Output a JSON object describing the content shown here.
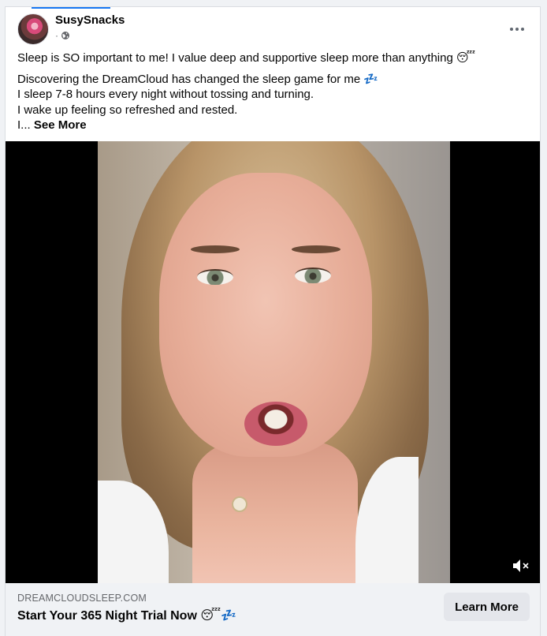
{
  "post": {
    "author": "SusySnacks",
    "meta_dot": "·",
    "privacy_icon": "globe-icon",
    "text_line1": "Sleep is SO important to me! I value deep and supportive sleep more than anything 😴",
    "text_para2_line1": "Discovering the DreamCloud has changed the sleep game for me 💤",
    "text_para2_line2": "I sleep 7-8 hours every night without tossing and turning.",
    "text_para2_line3": "I wake up feeling so refreshed and rested.",
    "text_truncated": "I...",
    "see_more_label": "See More"
  },
  "video": {
    "mute_icon": "speaker-muted-icon"
  },
  "link_preview": {
    "domain": "DREAMCLOUDSLEEP.COM",
    "headline": "Start Your 365 Night Trial Now 😴💤",
    "cta_label": "Learn More"
  },
  "colors": {
    "accent": "#1877f2",
    "footer_bg": "#f0f2f5",
    "button_bg": "#e4e6eb",
    "secondary_text": "#65676b"
  }
}
